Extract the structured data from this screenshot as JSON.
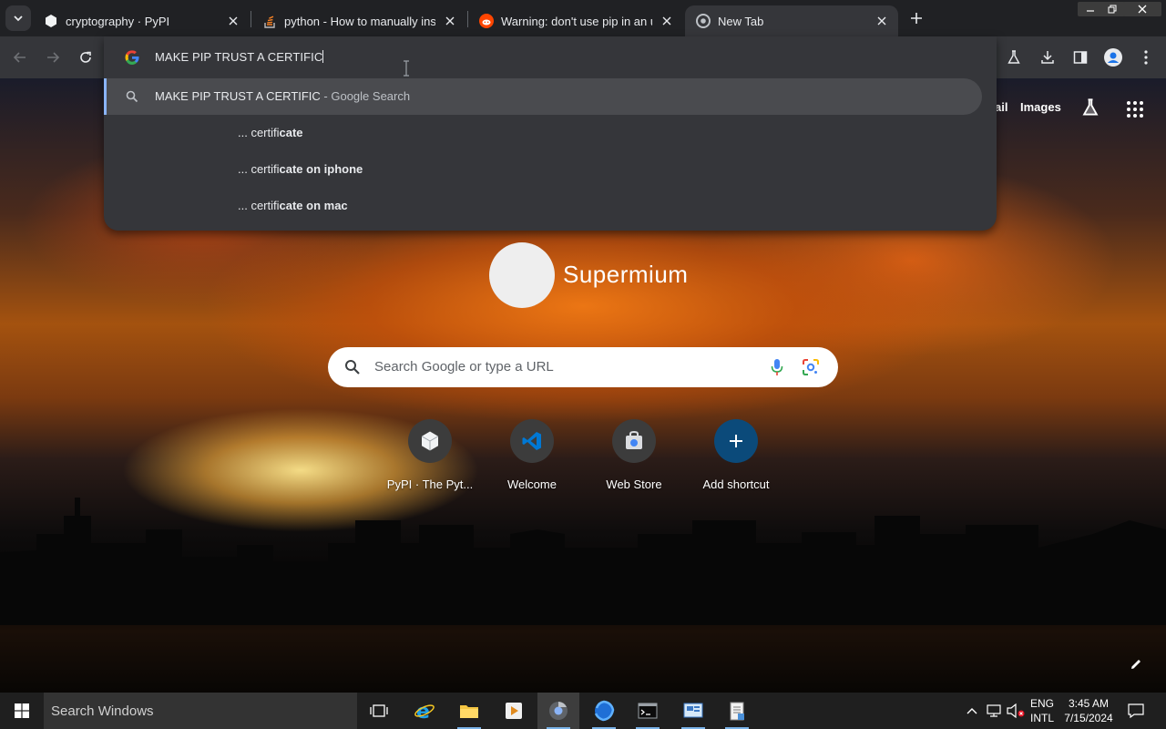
{
  "tabs": [
    {
      "title": "cryptography · PyPI",
      "favicon": "pypi-cube-icon"
    },
    {
      "title": "python - How to manually install",
      "favicon": "stackoverflow-icon"
    },
    {
      "title": "Warning: don't use pip in an un",
      "favicon": "reddit-icon"
    },
    {
      "title": "New Tab",
      "favicon": "chrome-icon",
      "active": true
    }
  ],
  "omnibox": {
    "input": "MAKE PIP TRUST A CERTIFIC",
    "top_suggestion": {
      "query": "MAKE PIP TRUST A CERTIFIC",
      "suffix": " - Google Search"
    },
    "suggestions": [
      {
        "prefix": "... certifi",
        "bold": "cate"
      },
      {
        "prefix": "... certifi",
        "bold": "cate on iphone"
      },
      {
        "prefix": "... certifi",
        "bold": "cate on mac"
      }
    ]
  },
  "ntp": {
    "links": {
      "gmail_partial": "ail",
      "images": "Images"
    },
    "logo_text": "Supermium",
    "search_placeholder": "Search Google or type a URL",
    "shortcuts": [
      {
        "label": "PyPI · The Pyt...",
        "icon": "pypi-cube-icon"
      },
      {
        "label": "Welcome",
        "icon": "vscode-icon"
      },
      {
        "label": "Web Store",
        "icon": "web-store-icon"
      },
      {
        "label": "Add shortcut",
        "icon": "plus-icon"
      }
    ]
  },
  "taskbar": {
    "search_text": "Search Windows",
    "lang_line1": "ENG",
    "lang_line2": "INTL",
    "time": "3:45 AM",
    "date": "7/15/2024"
  },
  "colors": {
    "frame": "#202124",
    "toolbar": "#35363a",
    "accent": "#8ab4f8",
    "taskbar": "#1f1f1f"
  }
}
